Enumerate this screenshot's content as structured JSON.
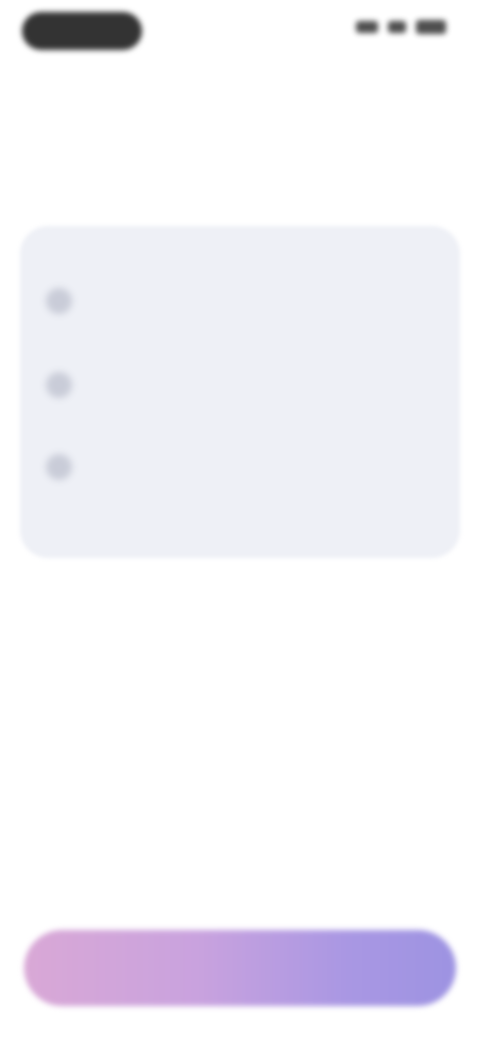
{
  "status_bar": {
    "time": "",
    "icons": [
      "signal-icon",
      "wifi-icon",
      "battery-icon"
    ]
  },
  "header": {
    "title": "",
    "subtitle": ""
  },
  "features": [
    {
      "icon": "circle-icon",
      "title": "",
      "description": ""
    },
    {
      "icon": "circle-icon",
      "title": "",
      "description": ""
    },
    {
      "icon": "circle-icon",
      "title": "",
      "description": ""
    }
  ],
  "primary_button": {
    "label": ""
  },
  "colors": {
    "background": "#ffffff",
    "card": "#eef0f6",
    "button_gradient_start": "#d9a8d6",
    "button_gradient_end": "#9d93e2"
  }
}
